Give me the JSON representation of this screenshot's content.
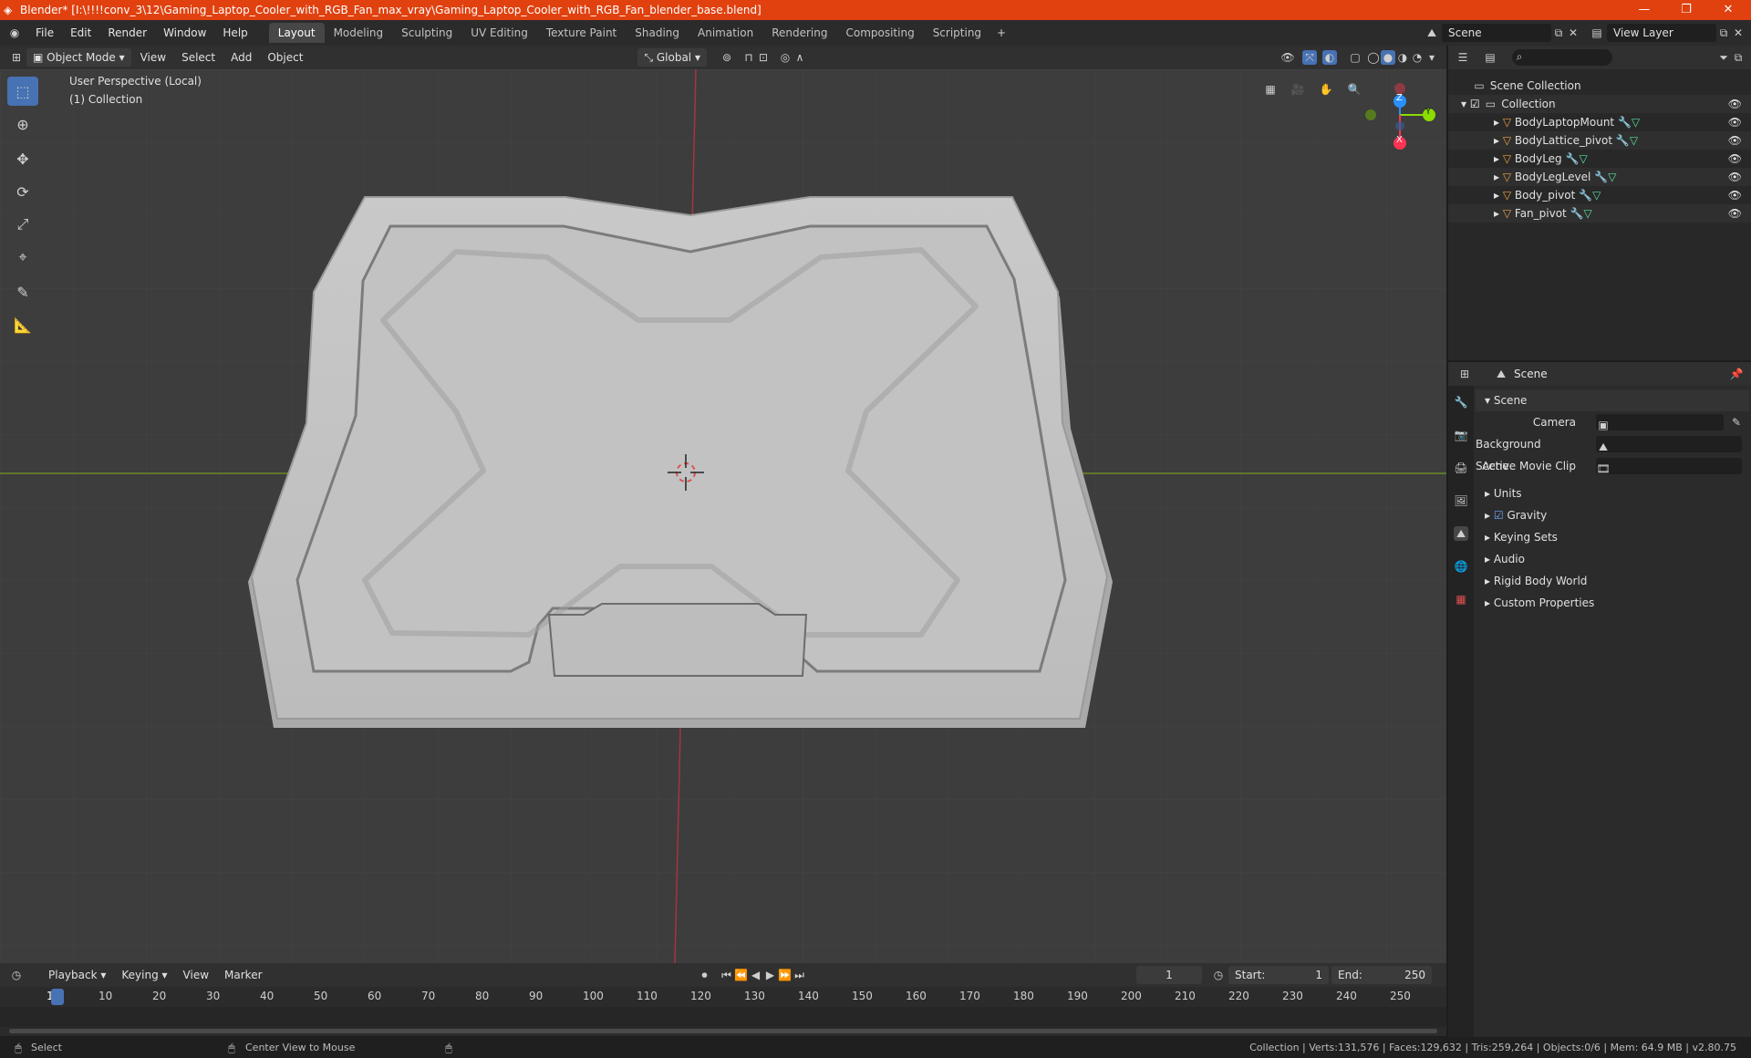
{
  "window": {
    "title": "Blender* [I:\\!!!!conv_3\\12\\Gaming_Laptop_Cooler_with_RGB_Fan_max_vray\\Gaming_Laptop_Cooler_with_RGB_Fan_blender_base.blend]",
    "minimize": "—",
    "maximize": "❐",
    "close": "✕"
  },
  "menu": [
    "File",
    "Edit",
    "Render",
    "Window",
    "Help"
  ],
  "workspaces": [
    "Layout",
    "Modeling",
    "Sculpting",
    "UV Editing",
    "Texture Paint",
    "Shading",
    "Animation",
    "Rendering",
    "Compositing",
    "Scripting"
  ],
  "active_workspace": "Layout",
  "scene_selector": "Scene",
  "view_layer": "View Layer",
  "viewport_header": {
    "mode": "Object Mode",
    "menus": [
      "View",
      "Select",
      "Add",
      "Object"
    ],
    "transform": "Global"
  },
  "viewport": {
    "perspective": "User Perspective (Local)",
    "collection": "(1) Collection",
    "axes": {
      "x": "X",
      "y": "Y",
      "z": "Z"
    }
  },
  "outliner": {
    "root": "Scene Collection",
    "collection": "Collection",
    "items": [
      "BodyLaptopMount",
      "BodyLattice_pivot",
      "BodyLeg",
      "BodyLegLevel",
      "Body_pivot",
      "Fan_pivot"
    ]
  },
  "properties": {
    "header": "Scene",
    "section": "Scene",
    "fields": [
      {
        "label": "Camera"
      },
      {
        "label": "Background Scene"
      },
      {
        "label": "Active Movie Clip"
      }
    ],
    "panels": [
      "Units",
      "Gravity",
      "Keying Sets",
      "Audio",
      "Rigid Body World",
      "Custom Properties"
    ]
  },
  "timeline": {
    "menus": [
      "Playback",
      "Keying",
      "View",
      "Marker"
    ],
    "current_frame": "1",
    "start_label": "Start:",
    "start": "1",
    "end_label": "End:",
    "end": "250",
    "ruler": [
      "1",
      "10",
      "20",
      "30",
      "40",
      "50",
      "60",
      "70",
      "80",
      "90",
      "100",
      "110",
      "120",
      "130",
      "140",
      "150",
      "160",
      "170",
      "180",
      "190",
      "200",
      "210",
      "220",
      "230",
      "240",
      "250"
    ]
  },
  "status": {
    "left": "Select",
    "middle": "Center View to Mouse",
    "right": "Collection | Verts:131,576 | Faces:129,632 | Tris:259,264 | Objects:0/6 | Mem: 64.9 MB | v2.80.75"
  },
  "colors": {
    "titlebar": "#e0410f",
    "accent": "#4772b3",
    "x_axis": "#ff3352",
    "y_axis": "#8bdc00",
    "z_axis": "#2890ff"
  }
}
